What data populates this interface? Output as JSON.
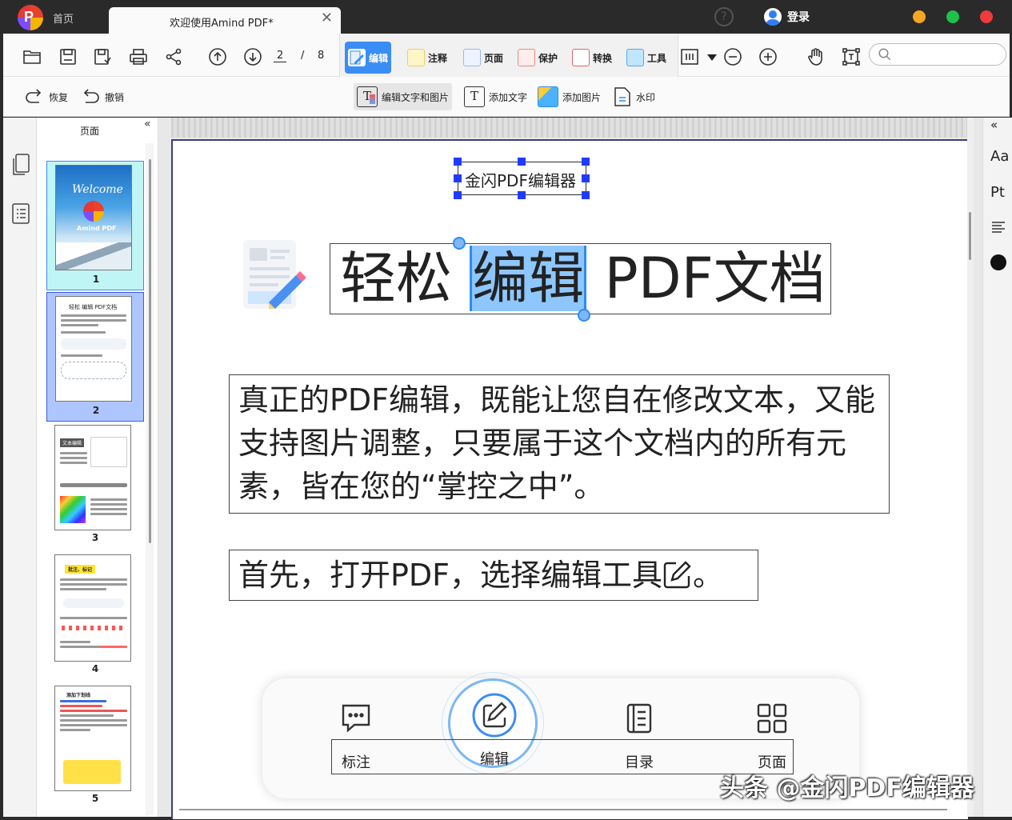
{
  "titlebar": {
    "home_tab": "首页",
    "doc_tab_title": "欢迎使用Amind PDF*",
    "close_glyph": "✕",
    "help_glyph": "?",
    "login_label": "登录",
    "window_buttons": [
      {
        "name": "minimize",
        "color": "#f5a623"
      },
      {
        "name": "maximize",
        "color": "#1fc14a"
      },
      {
        "name": "close",
        "color": "#ef3b3b"
      }
    ]
  },
  "toolbar": {
    "current_page": "2",
    "page_separator": "/",
    "total_pages": "8",
    "tabs": [
      {
        "label": "编辑",
        "icon": "edit-icon",
        "active": true
      },
      {
        "label": "注释",
        "icon": "comment-icon",
        "active": false
      },
      {
        "label": "页面",
        "icon": "page-icon",
        "active": false
      },
      {
        "label": "保护",
        "icon": "protect-icon",
        "active": false
      },
      {
        "label": "转换",
        "icon": "convert-icon",
        "active": false
      },
      {
        "label": "工具",
        "icon": "tools-icon",
        "active": false
      }
    ],
    "search_placeholder": ""
  },
  "subtoolbar": {
    "redo_label": "恢复",
    "undo_label": "撤销",
    "edit_text_image_label": "编辑文字和图片",
    "add_text_label": "添加文字",
    "add_image_label": "添加图片",
    "watermark_label": "水印"
  },
  "thumbnails": {
    "panel_title": "页面",
    "collapse_glyph": "«",
    "pages": [
      {
        "number": "1",
        "selected": false,
        "highlight": true,
        "cover_text_1": "Welcome",
        "cover_text_2": "Amind PDF"
      },
      {
        "number": "2",
        "selected": true,
        "highlight": false,
        "heading": "轻松 编辑 PDF文档"
      },
      {
        "number": "3",
        "selected": false,
        "highlight": false,
        "heading": "文本编辑"
      },
      {
        "number": "4",
        "selected": false,
        "highlight": false,
        "heading": "批注、标记"
      },
      {
        "number": "5",
        "selected": false,
        "highlight": false,
        "heading": "添加下划线"
      }
    ]
  },
  "document": {
    "selected_textbox": "金闪PDF编辑器",
    "title_part1": "轻松 ",
    "title_highlight": "编辑",
    "title_part2": " PDF文档",
    "paragraph_1": "真正的PDF编辑，既能让您自在修改文本，又能支持图片调整，只要属于这个文档内的所有元素，皆在您的“掌控之中”。",
    "paragraph_2_text": "首先，打开PDF，选择编辑工具",
    "paragraph_2_end": "。",
    "bottom_bar": [
      {
        "label": "标注",
        "icon": "annotation-icon"
      },
      {
        "label": "编辑",
        "icon": "edit-icon"
      },
      {
        "label": "目录",
        "icon": "outline-icon"
      },
      {
        "label": "页面",
        "icon": "grid-icon"
      }
    ]
  },
  "right_panel": {
    "collapse_glyph": "«",
    "font_label": "Aa",
    "size_label": "Pt"
  },
  "watermark_text": "头条 @金闪PDF编辑器"
}
